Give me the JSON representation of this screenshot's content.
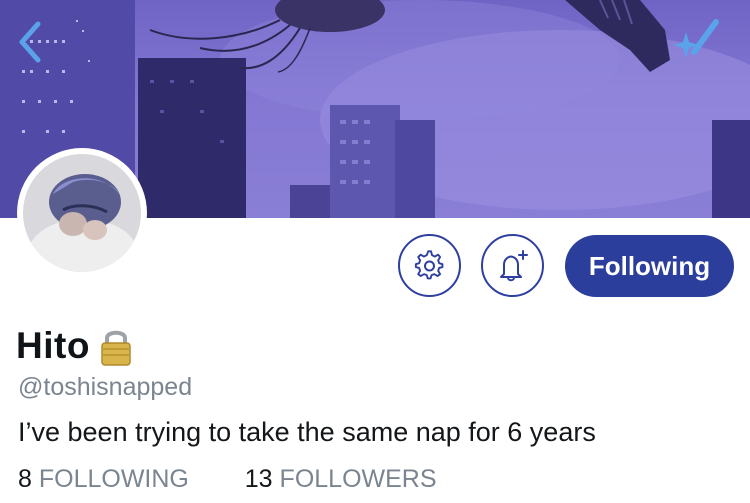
{
  "header": {
    "back_icon": "chevron-left-icon",
    "sparkle_icon": "sparkle-icon",
    "accent_color": "#5aa3ea"
  },
  "profile": {
    "display_name": "Hito",
    "lock_icon": "lock-icon",
    "handle": "@toshisnapped",
    "bio": "I’ve been trying to take the same nap for 6 years"
  },
  "actions": {
    "settings_icon": "gear-icon",
    "notify_icon": "bell-plus-icon",
    "follow_label": "Following",
    "button_color": "#2b3e9c"
  },
  "stats": {
    "following_count": "8",
    "following_label": "FOLLOWING",
    "followers_count": "13",
    "followers_label": "FOLLOWERS"
  }
}
